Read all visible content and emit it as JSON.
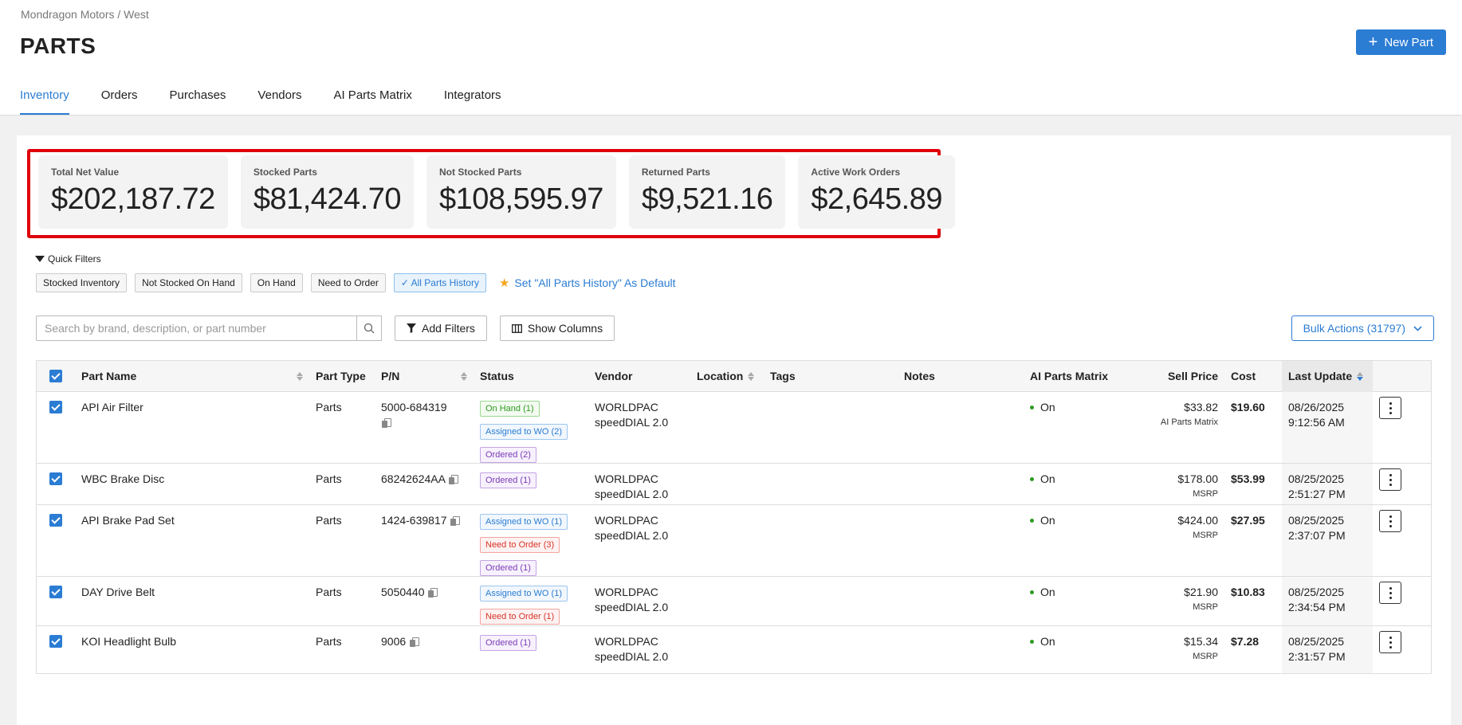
{
  "breadcrumb": "Mondragon Motors / West",
  "page_title": "PARTS",
  "new_part_label": "New Part",
  "tabs": [
    {
      "label": "Inventory",
      "active": true
    },
    {
      "label": "Orders"
    },
    {
      "label": "Purchases"
    },
    {
      "label": "Vendors"
    },
    {
      "label": "AI Parts Matrix"
    },
    {
      "label": "Integrators"
    }
  ],
  "stats": [
    {
      "label": "Total Net Value",
      "value": "$202,187.72"
    },
    {
      "label": "Stocked Parts",
      "value": "$81,424.70"
    },
    {
      "label": "Not Stocked Parts",
      "value": "$108,595.97"
    },
    {
      "label": "Returned Parts",
      "value": "$9,521.16"
    },
    {
      "label": "Active Work Orders",
      "value": "$2,645.89"
    }
  ],
  "quick_filters": {
    "title": "Quick Filters",
    "chips": [
      "Stocked Inventory",
      "Not Stocked On Hand",
      "On Hand",
      "Need to Order",
      "All Parts History"
    ],
    "set_default_label": "Set \"All Parts History\" As Default"
  },
  "toolbar": {
    "search_placeholder": "Search by brand, description, or part number",
    "add_filters_label": "Add Filters",
    "show_columns_label": "Show Columns",
    "bulk_actions_label": "Bulk Actions (31797)"
  },
  "columns": {
    "name": "Part Name",
    "type": "Part Type",
    "pn": "P/N",
    "status": "Status",
    "vendor": "Vendor",
    "location": "Location",
    "tags": "Tags",
    "notes": "Notes",
    "ai": "AI Parts Matrix",
    "sell": "Sell Price",
    "cost": "Cost",
    "updated": "Last Update"
  },
  "rows": [
    {
      "name": "API Air Filter",
      "type": "Parts",
      "pn": "5000-684319",
      "vendor1": "WORLDPAC",
      "vendor2": "speedDIAL 2.0",
      "ai": "On",
      "sell": "$33.82",
      "sell_sub": "AI Parts Matrix",
      "cost": "$19.60",
      "date": "08/26/2025",
      "time": "9:12:56 AM",
      "statuses": [
        {
          "label": "On Hand (1)",
          "color": "green"
        },
        {
          "label": "Assigned to WO (2)",
          "color": "blue"
        },
        {
          "label": "Ordered (2)",
          "color": "purple"
        }
      ]
    },
    {
      "name": "WBC Brake Disc",
      "type": "Parts",
      "pn": "68242624AA",
      "vendor1": "WORLDPAC",
      "vendor2": "speedDIAL 2.0",
      "ai": "On",
      "sell": "$178.00",
      "sell_sub": "MSRP",
      "cost": "$53.99",
      "date": "08/25/2025",
      "time": "2:51:27 PM",
      "statuses": [
        {
          "label": "Ordered (1)",
          "color": "purple"
        }
      ]
    },
    {
      "name": "API Brake Pad Set",
      "type": "Parts",
      "pn": "1424-639817",
      "vendor1": "WORLDPAC",
      "vendor2": "speedDIAL 2.0",
      "ai": "On",
      "sell": "$424.00",
      "sell_sub": "MSRP",
      "cost": "$27.95",
      "date": "08/25/2025",
      "time": "2:37:07 PM",
      "statuses": [
        {
          "label": "Assigned to WO (1)",
          "color": "blue"
        },
        {
          "label": "Need to Order (3)",
          "color": "red"
        },
        {
          "label": "Ordered (1)",
          "color": "purple"
        }
      ]
    },
    {
      "name": "DAY Drive Belt",
      "type": "Parts",
      "pn": "5050440",
      "vendor1": "WORLDPAC",
      "vendor2": "speedDIAL 2.0",
      "ai": "On",
      "sell": "$21.90",
      "sell_sub": "MSRP",
      "cost": "$10.83",
      "date": "08/25/2025",
      "time": "2:34:54 PM",
      "statuses": [
        {
          "label": "Assigned to WO (1)",
          "color": "blue"
        },
        {
          "label": "Need to Order (1)",
          "color": "red"
        }
      ]
    },
    {
      "name": "KOI Headlight Bulb",
      "type": "Parts",
      "pn": "9006",
      "vendor1": "WORLDPAC",
      "vendor2": "speedDIAL 2.0",
      "ai": "On",
      "sell": "$15.34",
      "sell_sub": "MSRP",
      "cost": "$7.28",
      "date": "08/25/2025",
      "time": "2:31:57 PM",
      "statuses": [
        {
          "label": "Ordered (1)",
          "color": "purple"
        }
      ]
    }
  ],
  "colors": {
    "accent": "#2b7cd3",
    "highlight_border": "#e0000a",
    "star": "#f5a623"
  }
}
